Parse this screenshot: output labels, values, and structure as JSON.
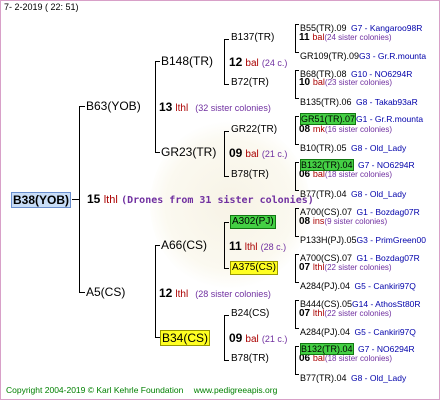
{
  "header": {
    "datetime": "7-  2-2019 ( 22: 51)"
  },
  "root": {
    "id": "B38(YOB)"
  },
  "gen1": {
    "num": "15",
    "line": "lthl",
    "sisters": "(Drones from 31 sister colonies)"
  },
  "sire": {
    "id": "B63(YOB)",
    "num": "13",
    "line": "lthl",
    "sisters": "(32 sister colonies)"
  },
  "dam": {
    "id": "A5(CS)",
    "num": "12",
    "line": "lthl",
    "sisters": "(28 sister colonies)"
  },
  "b148": {
    "id": "B148(TR)",
    "num": "12",
    "line": "bal",
    "sisters": "(24 c.)"
  },
  "gr23": {
    "id": "GR23(TR)",
    "num": "09",
    "line": "bal",
    "sisters": "(21 c.)"
  },
  "a66": {
    "id": "A66(CS)",
    "num": "11",
    "line": "lthl",
    "sisters": "(28 c.)"
  },
  "b34": {
    "id": "B34(CS)",
    "num": "09",
    "line": "bal",
    "sisters": "(21 c.)"
  },
  "g4": {
    "b137": {
      "id": "B137(TR)",
      "num": "11",
      "line": "bal",
      "sisters": "(24 sister colonies)"
    },
    "b72": {
      "id": "B72(TR)",
      "num": "10",
      "line": "bal",
      "sisters": "(23 sister colonies)"
    },
    "gr22": {
      "id": "GR22(TR)",
      "num": "08",
      "line": "mk",
      "sisters": "(16 sister colonies)"
    },
    "b78a": {
      "id": "B78(TR)",
      "num": "06",
      "line": "bal",
      "sisters": "(18 sister colonies)"
    },
    "a302": {
      "id": "A302(PJ)",
      "num": "08",
      "line": "ins",
      "sisters": "(9 sister colonies)"
    },
    "a375": {
      "id": "A375(CS)",
      "num": "07",
      "line": "lthl",
      "sisters": "(22 sister colonies)"
    },
    "b24": {
      "id": "B24(CS)",
      "num": "07",
      "line": "lthl",
      "sisters": "(22 sister colonies)"
    },
    "b78b": {
      "id": "B78(TR)",
      "num": "06",
      "line": "bal",
      "sisters": "(18 sister colonies)"
    }
  },
  "leaves": [
    {
      "id": "B55(TR).09",
      "info": "G7 - Kangaroo98R"
    },
    {
      "id": "GR109(TR).09",
      "info": "G3 - Gr.R.mounta"
    },
    {
      "id": "B68(TR).08",
      "info": "G10 - NO6294R"
    },
    {
      "id": "B135(TR).06",
      "info": "G8 - Takab93aR"
    },
    {
      "id": "GR51(TR).07",
      "info": "G1 - Gr.R.mounta"
    },
    {
      "id": "B10(TR).05",
      "info": "G8 - Old_Lady"
    },
    {
      "id": "B132(TR).04",
      "info": "G7 - NO6294R"
    },
    {
      "id": "B77(TR).04",
      "info": "G8 - Old_Lady"
    },
    {
      "id": "A700(CS).07",
      "info": "G1 - Bozdag07R"
    },
    {
      "id": "P133H(PJ).05",
      "info": "G3 - PrimGreen00"
    },
    {
      "id": "A700(CS).07",
      "info": "G1 - Bozdag07R"
    },
    {
      "id": "A284(PJ).04",
      "info": "G5 - Cankiri97Q"
    },
    {
      "id": "B444(CS).05",
      "info": "G14 - AthosSt80R"
    },
    {
      "id": "A284(PJ).04",
      "info": "G5 - Cankiri97Q"
    },
    {
      "id": "B132(TR).04",
      "info": "G7 - NO6294R"
    },
    {
      "id": "B77(TR).04",
      "info": "G8 - Old_Lady"
    }
  ],
  "footer": {
    "copyright": "Copyright 2004-2019 © Karl Kehrle Foundation",
    "url": "www.pedigreeapis.org"
  }
}
